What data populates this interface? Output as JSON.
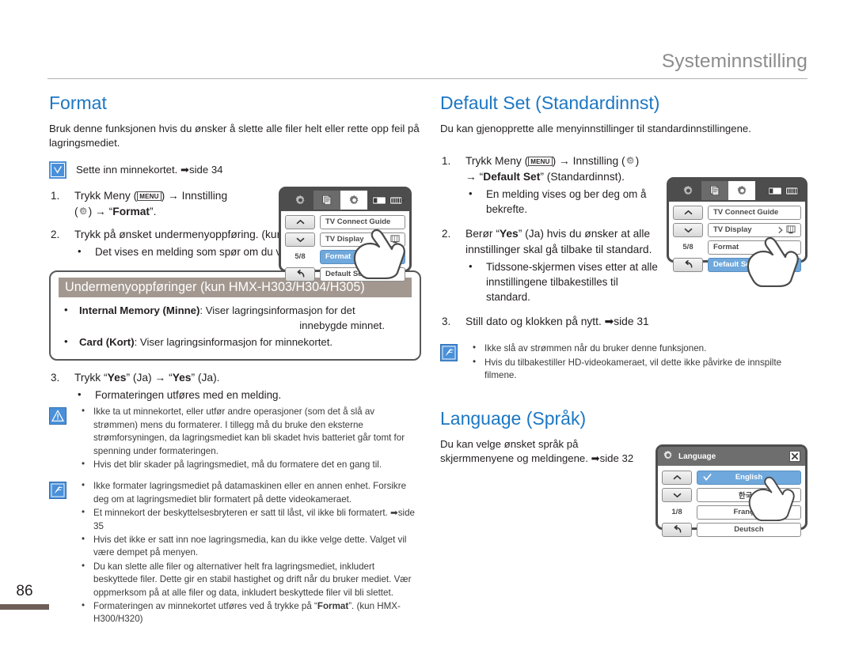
{
  "header": {
    "title": "Systeminnstilling"
  },
  "page": {
    "number": "86"
  },
  "left": {
    "title": "Format",
    "intro": "Bruk denne funksjonen hvis du ønsker å slette alle filer helt eller rette opp feil på lagringsmediet.",
    "tip": "Sette inn minnekortet. ➡side 34",
    "step1_num": "1.",
    "step1_a": "Trykk Meny (",
    "step1_menu": "MENU",
    "step1_b": ") → Innstilling",
    "step1_c": ") → “",
    "step1_bold": "Format",
    "step1_d": "”.",
    "step2_num": "2.",
    "step2_text": "Trykk på ønsket undermenyoppføring. (kun HMX-H303/H304/H305)",
    "step2_sub": "Det vises en melding som spør om du vil formatere minnekortet.",
    "box_head": "Undermenyoppføringer (kun HMX-H303/H304/H305)",
    "box_item1_bold": "Internal Memory (Minne)",
    "box_item1_rest": ": Viser lagringsinformasjon for det",
    "box_item1_line2": "innebygde minnet.",
    "box_item2_bold": "Card (Kort)",
    "box_item2_rest": ": Viser lagringsinformasjon for minnekortet.",
    "step3_num": "3.",
    "step3_a": "Trykk “",
    "step3_yes1": "Yes",
    "step3_b": "” (Ja) → “",
    "step3_yes2": "Yes",
    "step3_c": "” (Ja).",
    "step3_sub": "Formateringen utføres med en melding.",
    "warn1": "Ikke ta ut minnekortet, eller utfør andre operasjoner (som det å slå av strømmen) mens du formaterer. I tillegg må du bruke den eksterne strømforsyningen, da lagringsmediet kan bli skadet hvis batteriet går tomt for spenning under formateringen.",
    "warn2": "Hvis det blir skader på lagringsmediet, må du formatere det en gang til.",
    "note1": "Ikke formater lagringsmediet på datamaskinen eller en annen enhet. Forsikre deg om at lagringsmediet blir formatert på dette videokameraet.",
    "note2": "Et minnekort der beskyttelsesbryteren er satt til låst, vil ikke bli formatert. ➡side 35",
    "note3": "Hvis det ikke er satt inn noe lagringsmedia, kan du ikke velge dette. Valget vil være dempet på menyen.",
    "note4": "Du kan slette alle filer og alternativer helt fra lagringsmediet, inkludert beskyttede filer. Dette gir en stabil hastighet og drift når du bruker mediet. Vær oppmerksom på at alle filer og data, inkludert beskyttede filer vil bli slettet.",
    "note5_a": "Formateringen av minnekortet utføres ved å trykke på “",
    "note5_bold": "Format",
    "note5_b": "”. (kun HMX-H300/H320)"
  },
  "right": {
    "title": "Default Set (Standardinnst)",
    "intro": "Du kan gjenopprette alle menyinnstillinger til standardinnstillingene.",
    "step1_num": "1.",
    "step1_a": "Trykk Meny (",
    "step1_menu": "MENU",
    "step1_b": ") → Innstilling (",
    "step1_c": ")",
    "step1_line2_arrow": "→ “",
    "step1_bold": "Default Set",
    "step1_line2_rest": "” (Standardinnst).",
    "step1_sub": "En melding vises og ber deg om å bekrefte.",
    "step2_num": "2.",
    "step2_a": "Berør “",
    "step2_bold": "Yes",
    "step2_b": "” (Ja) hvis du ønsker at alle innstillinger skal gå tilbake til standard.",
    "step2_sub": "Tidssone-skjermen vises etter at alle innstillingene tilbakestilles til standard.",
    "step3_num": "3.",
    "step3_text": "Still dato og klokken på nytt. ➡side 31",
    "note1": "Ikke slå av strømmen når du bruker denne funksjonen.",
    "note2": "Hvis du tilbakestiller HD-videokameraet, vil dette ikke påvirke de innspilte filmene.",
    "lang_title": "Language (Språk)",
    "lang_intro": "Du kan velge ønsket språk på skjermmenyene og meldingene. ➡side 32"
  },
  "lcd_format": {
    "page_indicator": "5/8",
    "items": [
      {
        "label": "TV Connect Guide",
        "highlight": false,
        "indicator": ""
      },
      {
        "label": "TV Display",
        "highlight": false,
        "indicator": "tv"
      },
      {
        "label": "Format",
        "highlight": true,
        "indicator": ""
      },
      {
        "label": "Default Set",
        "highlight": false,
        "indicator": ""
      }
    ]
  },
  "lcd_default": {
    "page_indicator": "5/8",
    "items": [
      {
        "label": "TV Connect Guide",
        "highlight": false,
        "indicator": ""
      },
      {
        "label": "TV Display",
        "highlight": false,
        "indicator": "tv"
      },
      {
        "label": "Format",
        "highlight": false,
        "indicator": ""
      },
      {
        "label": "Default Set",
        "highlight": true,
        "indicator": ""
      }
    ]
  },
  "lcd_language": {
    "title": "Language",
    "page_indicator": "1/8",
    "items": [
      {
        "label": "English",
        "highlight": true,
        "checked": true
      },
      {
        "label": "한국어",
        "highlight": false,
        "checked": false
      },
      {
        "label": "Français",
        "highlight": false,
        "checked": false
      },
      {
        "label": "Deutsch",
        "highlight": false,
        "checked": false
      }
    ]
  },
  "colors": {
    "accent_blue": "#1c77c3",
    "icon_blue": "#4a90d9",
    "highlight_blue": "#6fa8dc",
    "box_head_taupe": "#a39890",
    "page_bar": "#6d5f57",
    "header_gray": "#8c8c8c"
  }
}
